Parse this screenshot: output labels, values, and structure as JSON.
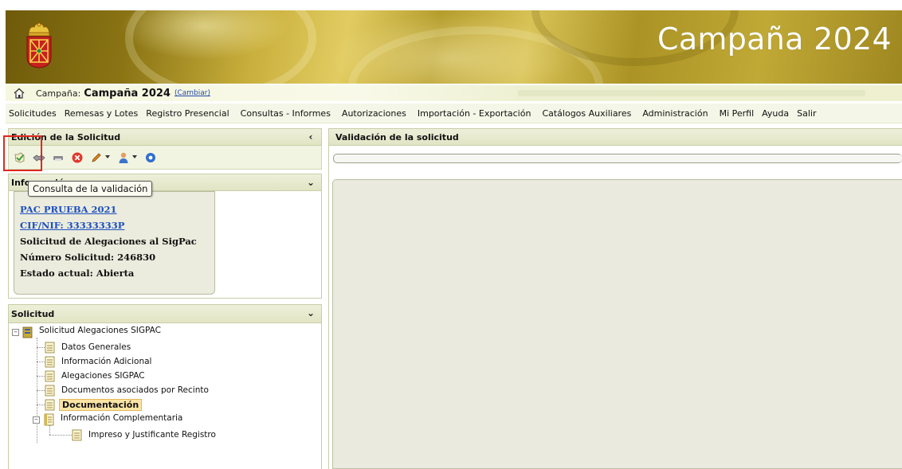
{
  "banner": {
    "title": "Campaña 2024",
    "logo_icon": "navarra-coat-of-arms"
  },
  "campaign_bar": {
    "home_icon": "home-icon",
    "prefix": "Campaña:",
    "value": "Campaña 2024",
    "change_link": "(Cambiar)"
  },
  "menu": {
    "items": [
      "Solicitudes",
      "Remesas y Lotes",
      "Registro Presencial",
      "Consultas - Informes",
      "Autorizaciones",
      "Importación - Exportación",
      "Catálogos Auxiliares",
      "Administración",
      "Mi Perfil",
      "Ayuda",
      "Salir"
    ]
  },
  "edit_panel": {
    "title": "Edición de la Solicitud",
    "collapse_icon": "chevron-left-icon",
    "toolbar_icons": [
      "validation-check-icon",
      "handshake-icon",
      "print-icon",
      "delete-icon",
      "sign-pen-icon",
      "user-icon",
      "info-icon"
    ],
    "tooltip": "Consulta de la validación"
  },
  "info_panel": {
    "title": "Información",
    "lines": {
      "name": "PAC PRUEBA 2021",
      "cif": "CIF/NIF: 33333333P",
      "type": "Solicitud de Alegaciones al SigPac",
      "number": "Número Solicitud: 246830",
      "status": "Estado actual: Abierta"
    }
  },
  "solicitud_panel": {
    "title": "Solicitud",
    "tree": {
      "root": "Solicitud Alegaciones SIGPAC",
      "children": [
        "Datos Generales",
        "Información Adicional",
        "Alegaciones SIGPAC",
        "Documentos asociados por Recinto",
        "Documentación"
      ],
      "complementary": "Información Complementaria",
      "complementary_children": [
        "Impreso y Justificante Registro"
      ],
      "selected": "Documentación"
    }
  },
  "main": {
    "title": "Validación de la solicitud",
    "progress": 0
  },
  "colors": {
    "banner_gold": "#c9af3c",
    "header_bg": "#e1e5c4",
    "highlight_red": "#e0281e",
    "selected_bg": "#fbe4a4",
    "link_blue": "#1d4fc0"
  }
}
